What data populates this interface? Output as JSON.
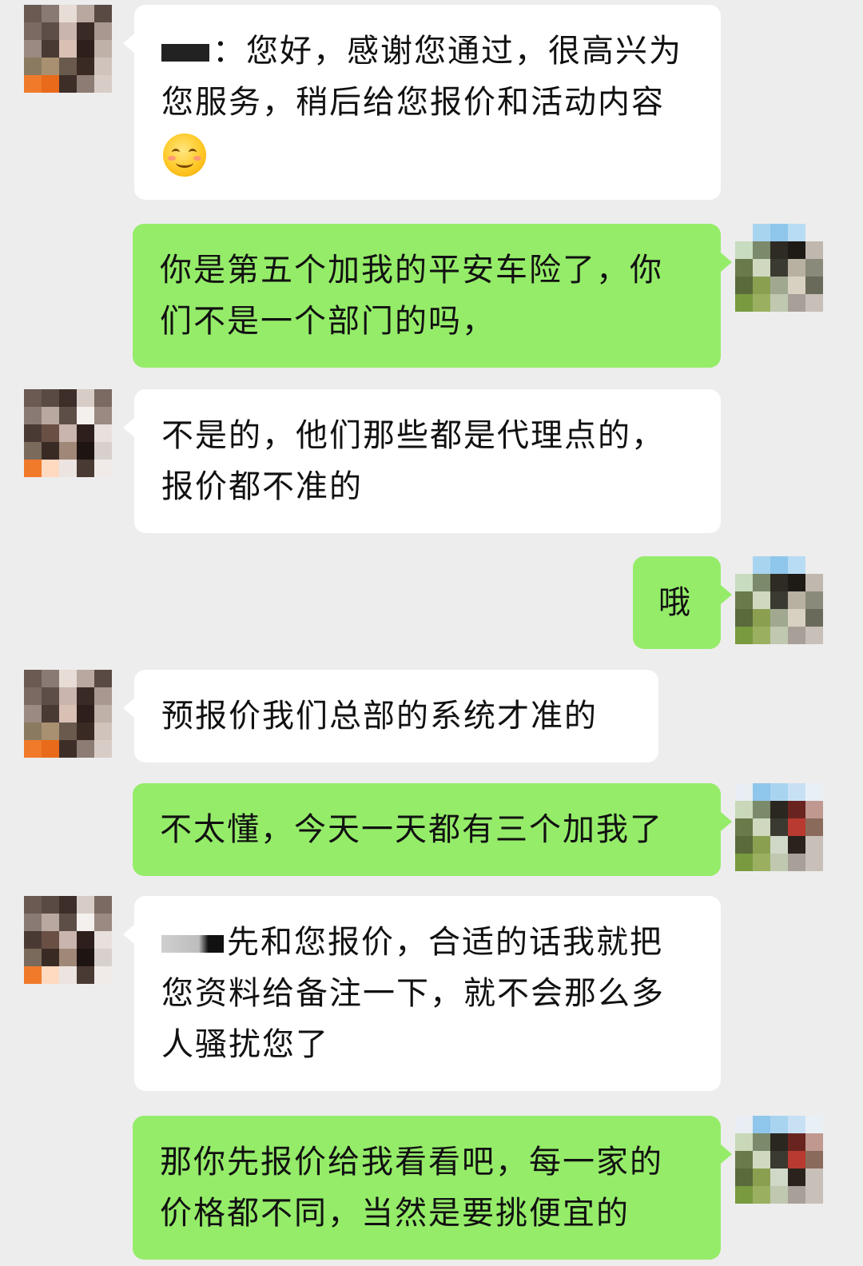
{
  "messages": [
    {
      "side": "them",
      "text": "：您好，感谢您通过，很高兴为您服务，稍后给您报价和活动内容",
      "emoji": "smiling-blush-emoji"
    },
    {
      "side": "me",
      "text": "你是第五个加我的平安车险了，你们不是一个部门的吗，"
    },
    {
      "side": "them",
      "text": "不是的，他们那些都是代理点的，报价都不准的"
    },
    {
      "side": "me",
      "text": "哦"
    },
    {
      "side": "them",
      "text": "预报价我们总部的系统才准的"
    },
    {
      "side": "me",
      "text": "不太懂，今天一天都有三个加我了"
    },
    {
      "side": "them",
      "text": "先和您报价，合适的话我就把您资料给备注一下，就不会那么多人骚扰您了"
    },
    {
      "side": "me",
      "text": "那你先报价给我看看吧，每一家的价格都不同，当然是要挑便宜的"
    }
  ],
  "colors": {
    "background": "#ededed",
    "bubble_them": "#ffffff",
    "bubble_me": "#95ec69"
  }
}
